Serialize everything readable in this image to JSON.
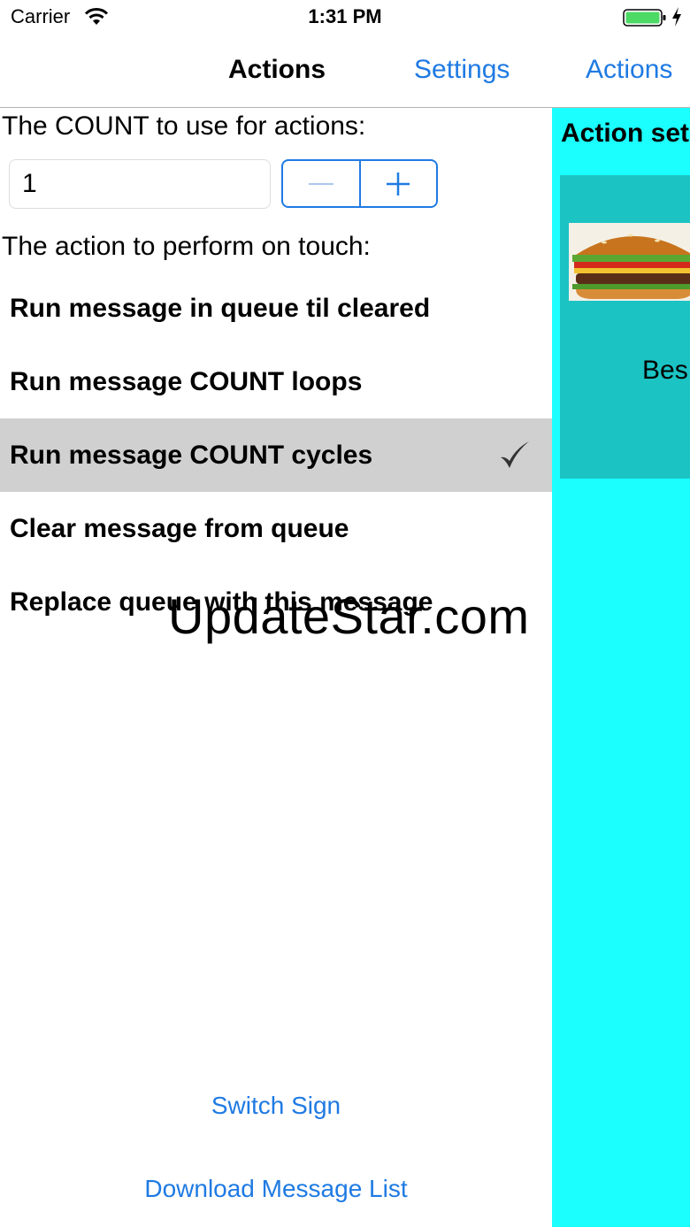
{
  "status_bar": {
    "carrier": "Carrier",
    "time": "1:31 PM",
    "battery_color": "#4cd964"
  },
  "nav": {
    "title": "Actions",
    "settings_label": "Settings",
    "actions_label": "Actions",
    "accent_color": "#1f7ae3"
  },
  "left": {
    "count_label": "The COUNT to use for actions:",
    "count_value": "1",
    "action_label": "The action to perform on touch:",
    "actions": [
      {
        "label": "Run message in queue til cleared",
        "selected": false
      },
      {
        "label": "Run message COUNT loops",
        "selected": false
      },
      {
        "label": "Run message COUNT cycles",
        "selected": true
      },
      {
        "label": "Clear message from queue",
        "selected": false
      },
      {
        "label": "Replace queue with this message",
        "selected": false
      }
    ],
    "switch_sign_label": "Switch Sign",
    "download_label": "Download Message List"
  },
  "right": {
    "title": "Action set",
    "preview_text": "Bes",
    "panel_color": "#1cffff",
    "card_color": "#1cc3c3"
  },
  "watermark": "UpdateStar.com"
}
